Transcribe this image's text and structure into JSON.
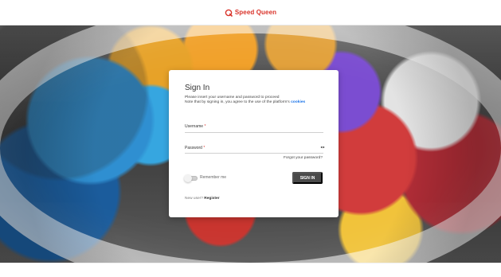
{
  "header": {
    "brand_name": "Speed Queen",
    "brand_color": "#d9332a",
    "brand_icon": "speed-queen-logo-icon"
  },
  "login": {
    "title": "Sign In",
    "instruction_line1": "Please insert your username and password to proceed",
    "instruction_line2_prefix": "Note that by signing in, you agree to the use of the platform's",
    "instruction_link": "cookies",
    "username_label": "Username",
    "password_label": "Password",
    "required_marker": "*",
    "forgot_password": "Forgot your password?",
    "remember_me": "Remember me",
    "sign_in_button": "SIGN IN",
    "new_user_prefix": "New user?",
    "register_link": "Register",
    "accent_color": "#1a73e8",
    "button_color": "#4a4a4a",
    "password_visibility_icon": "eye-icon"
  }
}
